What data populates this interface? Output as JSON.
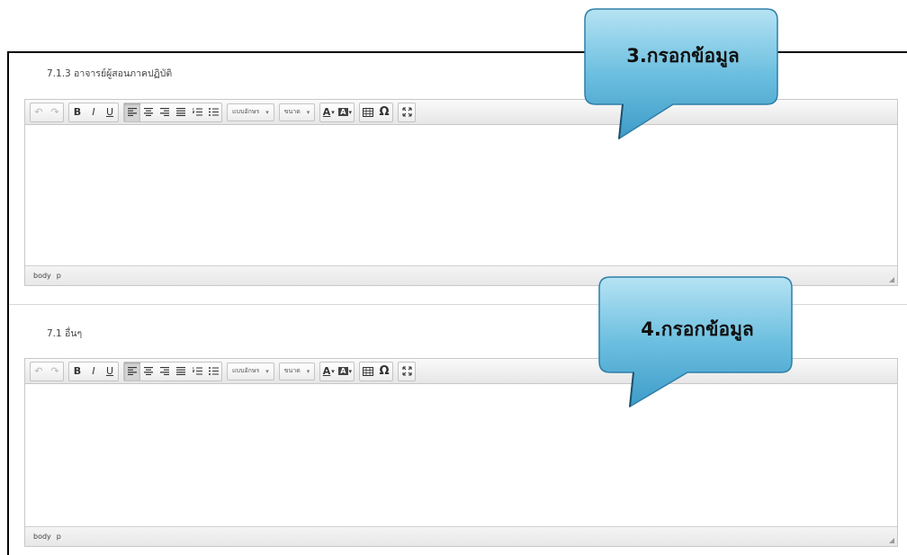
{
  "sections": [
    {
      "label": "7.1.3 อาจารย์ผู้สอนภาคปฏิบัติ",
      "status_path": [
        "body",
        "p"
      ]
    },
    {
      "label": "7.1 อื่นๆ",
      "status_path": [
        "body",
        "p"
      ]
    }
  ],
  "toolbar": {
    "undo_icon": "↶",
    "redo_icon": "↷",
    "bold": "B",
    "italic": "I",
    "underline": "U",
    "font_dropdown": "แบบอักษร",
    "size_dropdown": "ขนาด",
    "omega": "Ω",
    "caret": "▾",
    "font_color_letter": "A",
    "bg_color_letter": "A"
  },
  "callouts": [
    {
      "text": "3.กรอกข้อมูล"
    },
    {
      "text": "4.กรอกข้อมูล"
    }
  ],
  "colors": {
    "callout_fill_top": "#9bd5ec",
    "callout_fill_bottom": "#4aa6cf",
    "callout_border": "#3a8ab3",
    "frame": "#000000"
  }
}
